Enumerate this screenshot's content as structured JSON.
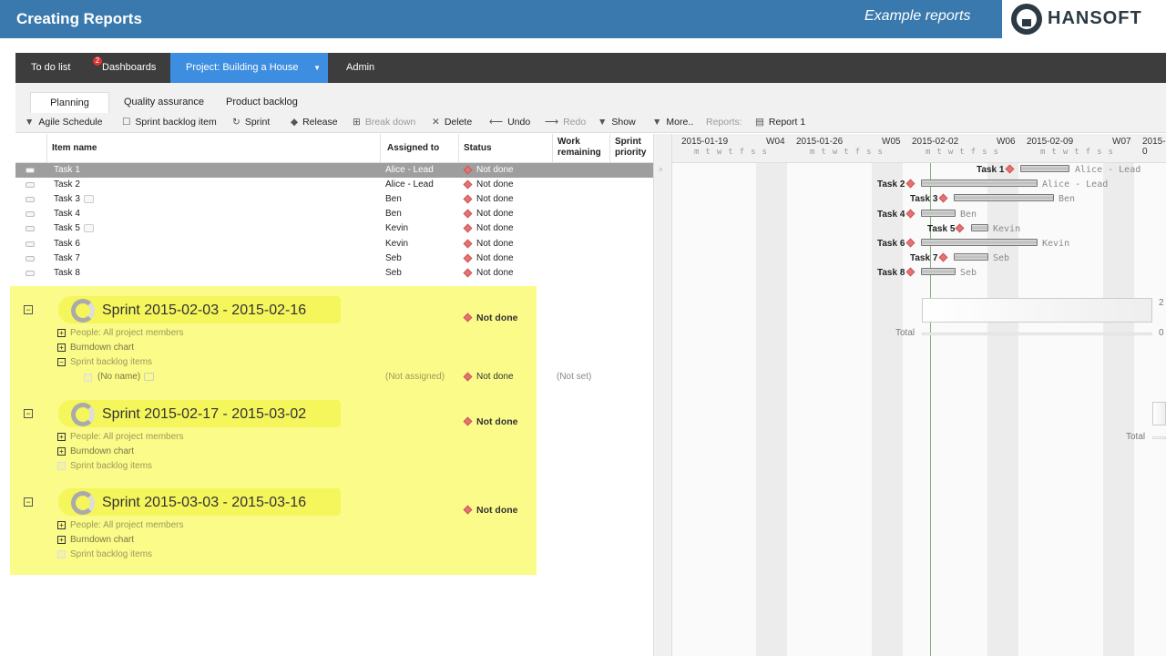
{
  "header": {
    "title": "Creating Reports",
    "subtitle": "Example reports",
    "logo_text": "HANSOFT"
  },
  "nav": {
    "todo": "To do list",
    "todo_badge": "2",
    "dashboards": "Dashboards",
    "project": "Project: Building a House",
    "admin": "Admin"
  },
  "tabs": {
    "planning": "Planning",
    "qa": "Quality assurance",
    "backlog": "Product backlog"
  },
  "toolbar": {
    "agile": "Agile Schedule",
    "sprint_item": "Sprint backlog item",
    "sprint": "Sprint",
    "release": "Release",
    "break_down": "Break down",
    "delete": "Delete",
    "undo": "Undo",
    "redo": "Redo",
    "show": "Show",
    "more": "More..",
    "reports": "Reports:",
    "report1": "Report 1"
  },
  "columns": {
    "item_name": "Item name",
    "assigned": "Assigned to",
    "status": "Status",
    "work": "Work remaining",
    "priority": "Sprint priority"
  },
  "tasks": [
    {
      "name": "Task 1",
      "assigned": "Alice - Lead",
      "status": "Not done"
    },
    {
      "name": "Task 2",
      "assigned": "Alice - Lead",
      "status": "Not done"
    },
    {
      "name": "Task 3",
      "assigned": "Ben",
      "status": "Not done"
    },
    {
      "name": "Task 4",
      "assigned": "Ben",
      "status": "Not done"
    },
    {
      "name": "Task 5",
      "assigned": "Kevin",
      "status": "Not done"
    },
    {
      "name": "Task 6",
      "assigned": "Kevin",
      "status": "Not done"
    },
    {
      "name": "Task 7",
      "assigned": "Seb",
      "status": "Not done"
    },
    {
      "name": "Task 8",
      "assigned": "Seb",
      "status": "Not done"
    }
  ],
  "sprints": [
    {
      "title": "Sprint 2015-02-03 - 2015-02-16",
      "status": "Not done",
      "people": "People: All project members",
      "burndown": "Burndown chart",
      "backlog": "Sprint backlog items",
      "child_name": "(No name)",
      "child_assigned": "(Not assigned)",
      "child_status": "Not done",
      "child_work": "(Not set)"
    },
    {
      "title": "Sprint 2015-02-17 - 2015-03-02",
      "status": "Not done",
      "people": "People: All project members",
      "burndown": "Burndown chart",
      "backlog": "Sprint backlog items"
    },
    {
      "title": "Sprint 2015-03-03 - 2015-03-16",
      "status": "Not done",
      "people": "People: All project members",
      "burndown": "Burndown chart",
      "backlog": "Sprint backlog items"
    }
  ],
  "gantt": {
    "dates": [
      "2015-01-19",
      "2015-01-26",
      "2015-02-02",
      "2015-02-09",
      "2015-0"
    ],
    "weeks": [
      "W04",
      "W05",
      "W06",
      "W07"
    ],
    "days": "mtwtfss",
    "rows": [
      {
        "label": "Task 1",
        "resource": "Alice -  Lead"
      },
      {
        "label": "Task 2",
        "resource": "Alice -  Lead"
      },
      {
        "label": "Task 3",
        "resource": "Ben"
      },
      {
        "label": "Task 4",
        "resource": "Ben"
      },
      {
        "label": "Task 5",
        "resource": "Kevin"
      },
      {
        "label": "Task 6",
        "resource": "Kevin"
      },
      {
        "label": "Task 7",
        "resource": "Seb"
      },
      {
        "label": "Task 8",
        "resource": "Seb"
      }
    ],
    "total": "Total",
    "edge_2": "2",
    "edge_0": "0"
  }
}
